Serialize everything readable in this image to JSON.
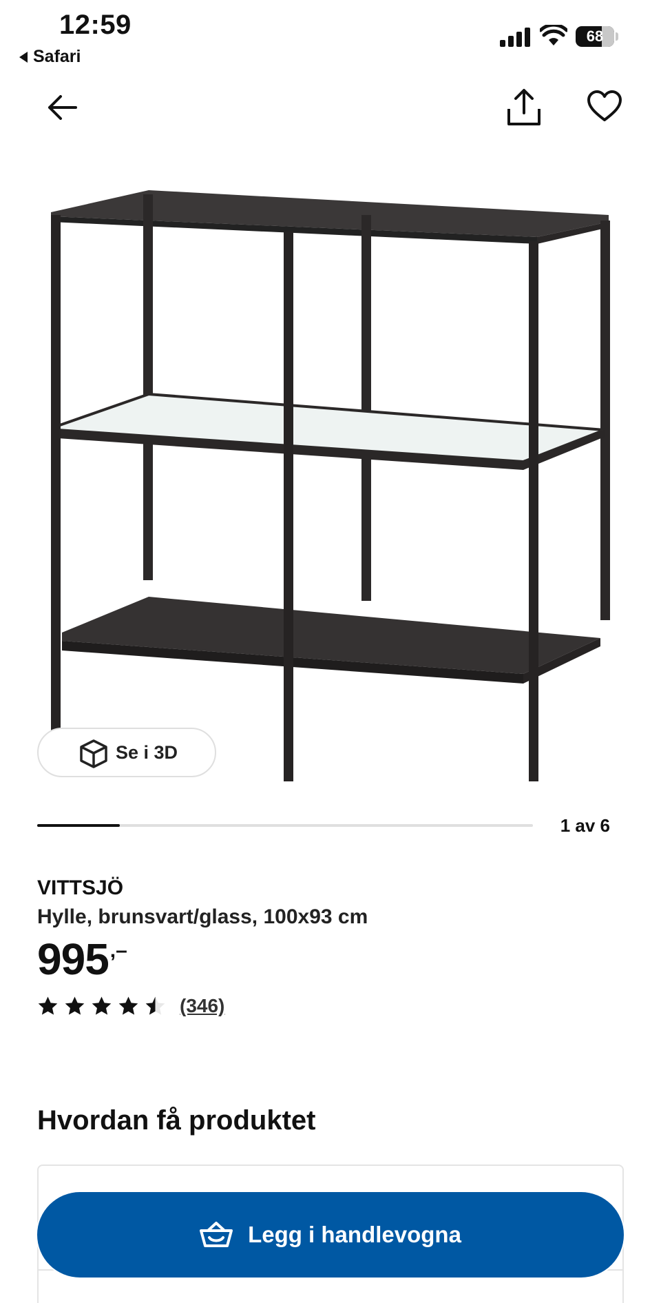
{
  "status_bar": {
    "time": "12:59",
    "back_app": "Safari",
    "battery_level": "68",
    "battery_fraction": 0.68
  },
  "nav": {
    "back_icon": "arrow-left-icon",
    "share_icon": "share-icon",
    "favorite_icon": "heart-icon"
  },
  "gallery": {
    "view_3d_label": "Se i 3D",
    "current_image": 1,
    "total_images": 6,
    "counter_text": "1 av 6"
  },
  "product": {
    "name": "VITTSJÖ",
    "description": "Hylle, brunsvart/glass, 100x93 cm",
    "price": "995",
    "price_suffix": ",–",
    "rating": 4.5,
    "rating_max": 5,
    "review_count": "(346)"
  },
  "section": {
    "title": "Hvordan få produktet"
  },
  "cart": {
    "label": "Legg i handlevogna",
    "icon": "shopping-basket-icon"
  },
  "colors": {
    "primary_button": "#0058a3",
    "text": "#111111",
    "border": "#dfdfdf"
  }
}
